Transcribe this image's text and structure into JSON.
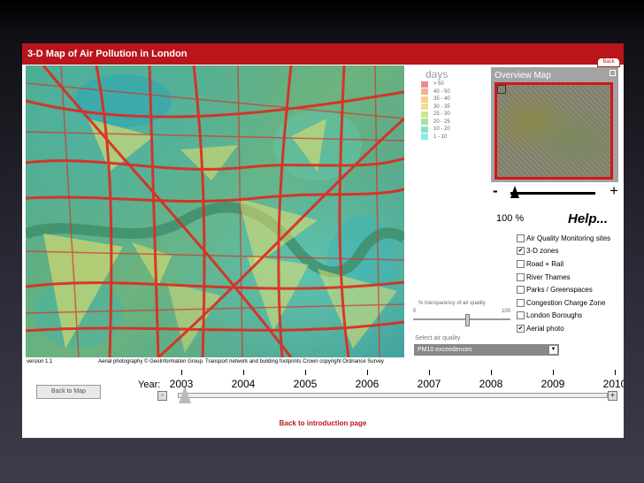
{
  "app": {
    "title": "3-D Map of Air Pollution in London",
    "back_tab_label": "Back"
  },
  "legend": {
    "title": "days",
    "items": [
      {
        "label": "> 50",
        "color": "#f08a8a"
      },
      {
        "label": "40 - 50",
        "color": "#f5b08b"
      },
      {
        "label": "35 - 40",
        "color": "#f7d08e"
      },
      {
        "label": "30 - 35",
        "color": "#e8e08e"
      },
      {
        "label": "25 - 30",
        "color": "#cfe68f"
      },
      {
        "label": "20 - 25",
        "color": "#a8e0a4"
      },
      {
        "label": "10 - 20",
        "color": "#88e0c9"
      },
      {
        "label": "1 - 10",
        "color": "#8de8ec"
      }
    ]
  },
  "overview": {
    "title": "Overview Map"
  },
  "zoom": {
    "minus": "-",
    "plus": "+",
    "value": "100",
    "unit": "%",
    "level": 0.05
  },
  "help_label": "Help...",
  "layers": [
    {
      "label": "Air Quality Monitoring sites",
      "checked": false
    },
    {
      "label": "3-D zones",
      "checked": true
    },
    {
      "label": "Road + Rail",
      "checked": false
    },
    {
      "label": "River Thames",
      "checked": false
    },
    {
      "label": "Parks / Greenspaces",
      "checked": false
    },
    {
      "label": "Congestion Charge Zone",
      "checked": false
    },
    {
      "label": "London Boroughs",
      "checked": false
    },
    {
      "label": "Aerial photo",
      "checked": true
    }
  ],
  "transparency": {
    "label": "% transparency of air quality",
    "min": "0",
    "max": "100",
    "value": 55
  },
  "air_quality": {
    "label": "Select air quality",
    "selected": "PM10 exceedences"
  },
  "footer": {
    "version": "version 1.1",
    "credits": "Aerial photography © GeoInformation Group. Transport network and building footprints Crown copyright Ordnance Survey"
  },
  "timeline": {
    "back_to_map": "Back to Map",
    "year_label": "Year:",
    "years": [
      "2003",
      "2004",
      "2005",
      "2006",
      "2007",
      "2008",
      "2009",
      "2010"
    ],
    "selected_year": "2003",
    "minus": "-",
    "plus": "+"
  },
  "intro_link": "Back to introduction page",
  "colors": {
    "brand_red": "#b9151b",
    "road_red": "#e0281e"
  }
}
